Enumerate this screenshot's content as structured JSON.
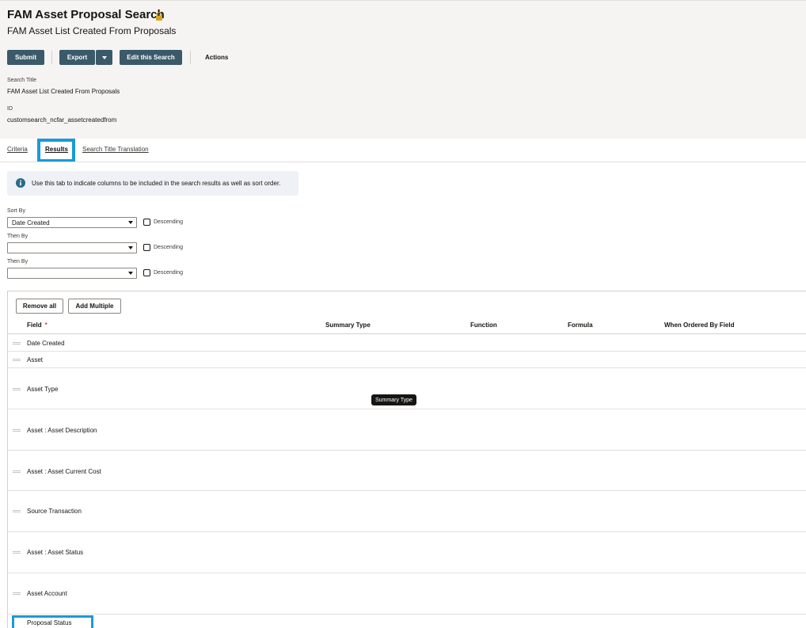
{
  "header": {
    "title": "FAM Asset Proposal Search",
    "subtitle": "FAM Asset List Created From Proposals",
    "lock_icon": "lock-icon"
  },
  "toolbar": {
    "submit_label": "Submit",
    "export_label": "Export",
    "edit_label": "Edit this Search",
    "actions_label": "Actions"
  },
  "meta": {
    "search_title_label": "Search Title",
    "search_title_value": "FAM Asset List Created From Proposals",
    "id_label": "ID",
    "id_value": "customsearch_ncfar_assetcreatedfrom"
  },
  "tabs": [
    {
      "label": "Criteria",
      "active": false
    },
    {
      "label": "Results",
      "active": true
    },
    {
      "label": "Search Title Translation",
      "active": false
    }
  ],
  "info": {
    "text": "Use this tab to indicate columns to be included in the search results as well as sort order.",
    "icon": "info-icon"
  },
  "sorting": [
    {
      "label": "Sort By",
      "value": "Date Created",
      "descending_label": "Descending",
      "descending": false
    },
    {
      "label": "Then By",
      "value": "",
      "descending_label": "Descending",
      "descending": false
    },
    {
      "label": "Then By",
      "value": "",
      "descending_label": "Descending",
      "descending": false
    }
  ],
  "results_table": {
    "remove_all_label": "Remove all",
    "add_multiple_label": "Add Multiple",
    "columns": [
      "Field",
      "Summary Type",
      "Function",
      "Formula",
      "When Ordered By Field"
    ],
    "required_marker": "*",
    "rows": [
      "Date Created",
      "Asset",
      "Asset Type",
      "Asset : Asset Description",
      "Asset : Asset Current Cost",
      "Source Transaction",
      "Asset : Asset Status",
      "Asset Account",
      "Proposal Status"
    ],
    "tooltip": "Summary Type"
  },
  "colors": {
    "button_dark": "#3a5a6a",
    "highlight": "#1a9bd7",
    "required": "#c74634",
    "info_icon": "#2a6b8a"
  }
}
